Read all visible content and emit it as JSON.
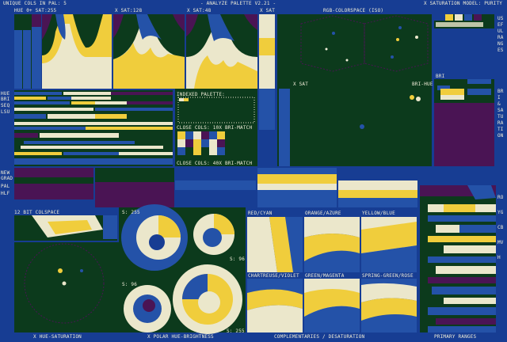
{
  "header": {
    "unique_cols": "UNIQUE COLS IN PAL: 5",
    "title": "- ANALYZE PALETTE V2.21 -",
    "saturation_model": "X SATURATION MODEL: PURITY",
    "hue_range": "HUE 0+ SAT:255",
    "sat128": "X SAT:128",
    "sat48": "X SAT:48",
    "sat_dots": "X SAT",
    "rgb_space": "RGB-COLORSPACE (ISO)"
  },
  "labels": {
    "bri_hue": "BRI-HUE",
    "bri": "BRI",
    "x_sat": "X SAT",
    "indexed_palette": "INDEXED PALETTE:",
    "close_cols_10": "CLOSE COLS: 10X BRI-MATCH",
    "close_cols_40": "CLOSE COLS: 40X BRI-MATCH",
    "colspace": "12 BIT COLSPACE",
    "s255": "S: 255",
    "s96": "S: 96",
    "s96b": "S: 96",
    "s255b": "S: 255",
    "red_cyan": "RED/CYAN",
    "orange_azure": "ORANGE/AZURE",
    "yellow_blue": "YELLOW/BLUE",
    "chartreuse_violet": "CHARTREUSE/VIOLET",
    "green_magenta": "GREEN/MAGENTA",
    "spring_rose": "SPRING-GREEN/ROSE"
  },
  "left_labels": [
    "HUE",
    "BRI",
    "SEQ",
    "LSU",
    "NEW",
    "GRAD",
    "PAL",
    "HLF"
  ],
  "right_labels": {
    "top": "USEFUL RANGES",
    "mid": "BRI & SATURATION",
    "bottom": "ROYGCBMVH"
  },
  "footer": {
    "hue_sat": "X HUE-SATURATION",
    "polar": "X POLAR HUE-BRIGHTNESS",
    "complementaries": "COMPLEMENTARIES / DESATURATION",
    "primary": "PRIMARY RANGES"
  },
  "colors": {
    "bg": "#173d93",
    "dark_green": "#0c3a1c",
    "blue": "#2452a8",
    "yellow": "#f0cd3c",
    "cream": "#ebe7cb",
    "purple": "#4a1454",
    "text": "#f0edd8"
  }
}
